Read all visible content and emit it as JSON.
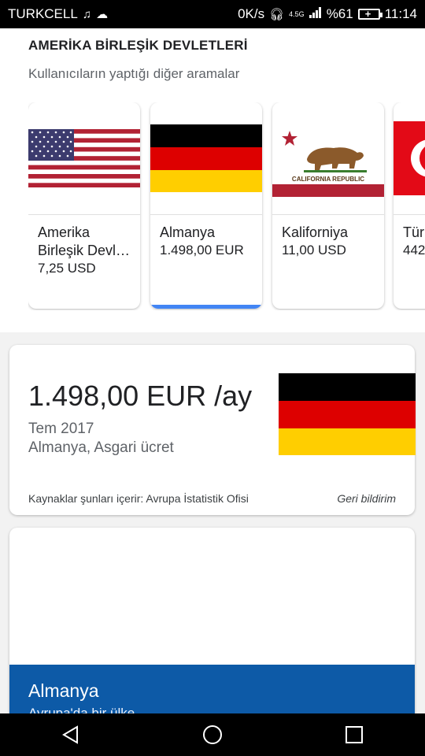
{
  "statusbar": {
    "carrier": "TURKCELL",
    "speed": "0K/s",
    "network": "4.5G",
    "battery": "%61",
    "time": "11:14"
  },
  "section": {
    "title": "AMERİKA BİRLEŞİK DEVLETLERİ",
    "subtitle": "Kullanıcıların yaptığı diğer aramalar"
  },
  "cards": [
    {
      "name": "Amerika Birleşik Devl…",
      "value": "7,25 USD"
    },
    {
      "name": "Almanya",
      "value": "1.498,00 EUR"
    },
    {
      "name": "Kaliforniya",
      "value": "11,00 USD"
    },
    {
      "name": "Tür",
      "value": "442"
    }
  ],
  "flag_text": {
    "california": "CALIFORNIA REPUBLIC"
  },
  "result": {
    "value": "1.498,00 EUR /ay",
    "date": "Tem 2017",
    "description": "Almanya, Asgari ücret",
    "sources": "Kaynaklar şunları içerir: Avrupa İstatistik Ofisi",
    "feedback": "Geri bildirim"
  },
  "knowledge": {
    "name": "Almanya",
    "subtitle": "Avrupa'da bir ülke"
  },
  "colors": {
    "accent": "#4285f4",
    "knowledge_blue": "#0d5aa7"
  }
}
